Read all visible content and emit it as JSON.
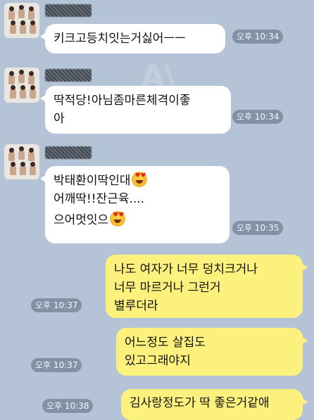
{
  "messages": [
    {
      "side": "left",
      "lines": [
        "키크고등치잇는거싫어ㅡㅡ"
      ],
      "time": "오후 10:34"
    },
    {
      "side": "left",
      "lines": [
        "딱적당!아님좀마른체격이좋",
        "아"
      ],
      "time": "오후 10:34"
    },
    {
      "side": "left",
      "lines": [
        "박태환이딱인대",
        "어깨딱!!잔근육....",
        "으어멋잇으"
      ],
      "time": "오후 10:35"
    },
    {
      "side": "right",
      "lines": [
        "나도 여자가 너무 덩치크거나",
        "너무 마르거나 그런거",
        "별루더라"
      ],
      "time": "오후 10:37"
    },
    {
      "side": "right",
      "lines": [
        "어느정도 살집도",
        "있고그래야지"
      ],
      "time": "오후 10:37"
    },
    {
      "side": "right",
      "lines": [
        "김사랑정도가 딱 좋은거같애"
      ],
      "time": "오후 10:38"
    }
  ],
  "emoji": "heart-eyes-emoji",
  "colors": {
    "background": "#b4c4d6",
    "incoming": "#ffffff",
    "outgoing": "#fdf17e"
  }
}
